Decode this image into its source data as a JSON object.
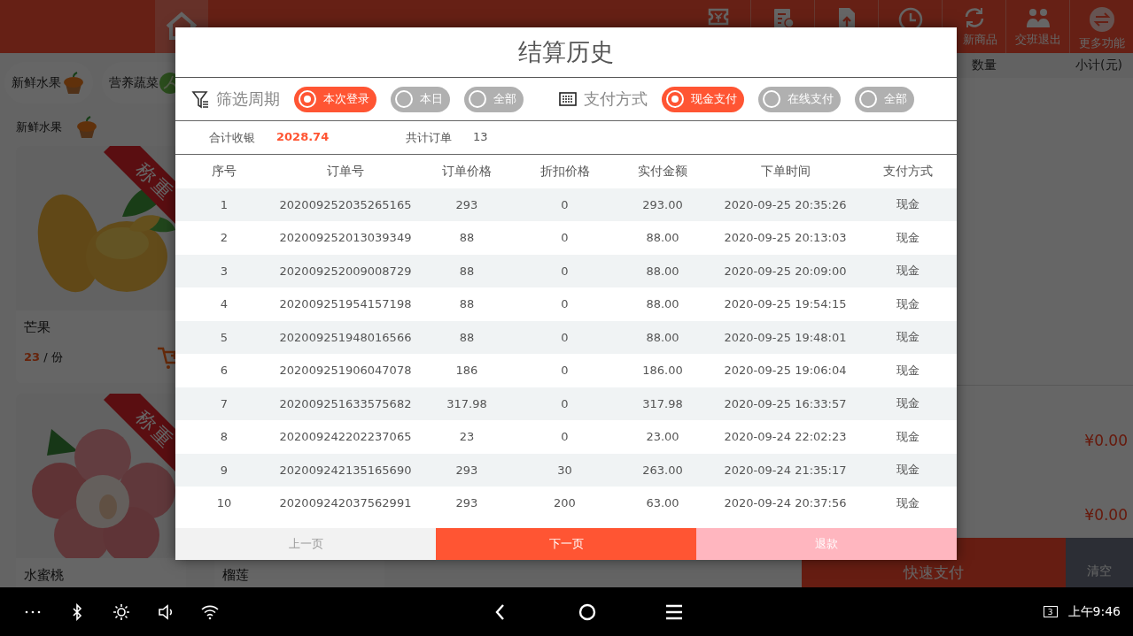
{
  "topbar": {
    "tools": [
      {
        "kind": "ticket"
      },
      {
        "kind": "report"
      },
      {
        "kind": "upload"
      },
      {
        "kind": "clock"
      },
      {
        "kind": "refresh",
        "label": "新商品"
      },
      {
        "kind": "users",
        "label": "交班退出"
      },
      {
        "kind": "more",
        "label": "更多功能"
      }
    ]
  },
  "categories": [
    {
      "label": "新鲜水果",
      "kind": "cupcake"
    },
    {
      "label": "营养蔬菜",
      "kind": "cabbage"
    }
  ],
  "section": {
    "title": "新鲜水果"
  },
  "products": [
    {
      "kind": "mango",
      "tag": "称重",
      "name": "芒果",
      "price": "23",
      "unit": "/ 份"
    },
    {
      "kind": "peach",
      "tag": "称重",
      "name": "水蜜桃"
    },
    {
      "kind": "blank",
      "name": "榴莲"
    }
  ],
  "cart": {
    "columns": [
      "数量",
      "小计(元)"
    ],
    "totals": [
      "¥0.00",
      "¥0.00"
    ],
    "buttons": [
      {
        "label": "快速支付",
        "kind": "primary"
      },
      {
        "label": "清空",
        "kind": "secondary"
      }
    ]
  },
  "dialog": {
    "title": "结算历史",
    "filters": [
      {
        "kind": "funnel",
        "label": "筛选周期",
        "options": [
          {
            "label": "本次登录",
            "selected": true
          },
          {
            "label": "本日",
            "selected": false
          },
          {
            "label": "全部",
            "selected": false
          }
        ]
      },
      {
        "kind": "cash",
        "label": "支付方式",
        "options": [
          {
            "label": "现金支付",
            "selected": true
          },
          {
            "label": "在线支付",
            "selected": false
          },
          {
            "label": "全部",
            "selected": false
          }
        ]
      }
    ],
    "summary": [
      {
        "label": "合计收银",
        "value": "2028.74",
        "emphasis": true
      },
      {
        "label": "共计订单",
        "value": "13",
        "emphasis": false
      }
    ],
    "table": {
      "columns": [
        "序号",
        "订单号",
        "订单价格",
        "折扣价格",
        "实付金额",
        "下单时间",
        "支付方式"
      ],
      "rows": [
        [
          "1",
          "202009252035265165",
          "293",
          "0",
          "293.00",
          "2020-09-25 20:35:26",
          "现金"
        ],
        [
          "2",
          "202009252013039349",
          "88",
          "0",
          "88.00",
          "2020-09-25 20:13:03",
          "现金"
        ],
        [
          "3",
          "202009252009008729",
          "88",
          "0",
          "88.00",
          "2020-09-25 20:09:00",
          "现金"
        ],
        [
          "4",
          "202009251954157198",
          "88",
          "0",
          "88.00",
          "2020-09-25 19:54:15",
          "现金"
        ],
        [
          "5",
          "202009251948016566",
          "88",
          "0",
          "88.00",
          "2020-09-25 19:48:01",
          "现金"
        ],
        [
          "6",
          "202009251906047078",
          "186",
          "0",
          "186.00",
          "2020-09-25 19:06:04",
          "现金"
        ],
        [
          "7",
          "202009251633575682",
          "317.98",
          "0",
          "317.98",
          "2020-09-25 16:33:57",
          "现金"
        ],
        [
          "8",
          "202009242202237065",
          "23",
          "0",
          "23.00",
          "2020-09-24 22:02:23",
          "现金"
        ],
        [
          "9",
          "202009242135165690",
          "293",
          "30",
          "263.00",
          "2020-09-24 21:35:17",
          "现金"
        ],
        [
          "10",
          "202009242037562991",
          "293",
          "200",
          "63.00",
          "2020-09-24 20:37:56",
          "现金"
        ]
      ]
    },
    "buttons": [
      {
        "label": "上一页",
        "kind": "neutral",
        "disabled": true
      },
      {
        "label": "下一页",
        "kind": "primary",
        "disabled": false
      },
      {
        "label": "退款",
        "kind": "danger",
        "disabled": true
      }
    ]
  },
  "navbar": {
    "date_badge": "3",
    "time": "上午9:46"
  }
}
